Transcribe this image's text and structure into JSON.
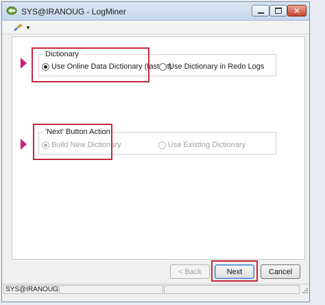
{
  "window": {
    "title": "SYS@IRANOUG - LogMiner",
    "icon": "database-arrows-icon",
    "close_glyph": "✕"
  },
  "toolbar": {
    "dropdown_glyph": "▼"
  },
  "dictionary_group": {
    "title": "Dictionary",
    "options": [
      {
        "label": "Use Online Data Dictionary (fastest)",
        "selected": true,
        "enabled": true
      },
      {
        "label": "Use Dictionary in Redo Logs",
        "selected": false,
        "enabled": true
      }
    ]
  },
  "next_action_group": {
    "title": "'Next' Button Action",
    "options": [
      {
        "label": "Build New Dictionary",
        "selected": true,
        "enabled": false
      },
      {
        "label": "Use Existing Dictionary",
        "selected": false,
        "enabled": false
      }
    ]
  },
  "buttons": {
    "back": "< Back",
    "next": "Next",
    "cancel": "Cancel"
  },
  "statusbar": {
    "connection": "SYS@IRANOUG"
  },
  "colors": {
    "highlight": "#c8253b",
    "pointer": "#cc1f78"
  }
}
